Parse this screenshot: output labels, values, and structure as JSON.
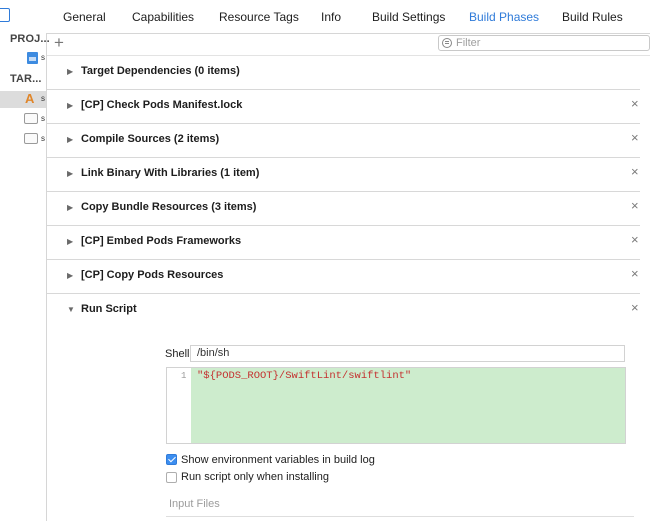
{
  "tabs": [
    "General",
    "Capabilities",
    "Resource Tags",
    "Info",
    "Build Settings",
    "Build Phases",
    "Build Rules"
  ],
  "active_tab": "Build Phases",
  "sidebar": {
    "project_header": "PROJ...",
    "targets_header": "TAR...",
    "item_initial": "s"
  },
  "toolbar": {
    "add_label": "+",
    "filter_placeholder": "Filter"
  },
  "phases": [
    {
      "title": "Target Dependencies (0 items)",
      "expanded": false,
      "removable": false
    },
    {
      "title": "[CP] Check Pods Manifest.lock",
      "expanded": false,
      "removable": true
    },
    {
      "title": "Compile Sources (2 items)",
      "expanded": false,
      "removable": true
    },
    {
      "title": "Link Binary With Libraries (1 item)",
      "expanded": false,
      "removable": true
    },
    {
      "title": "Copy Bundle Resources (3 items)",
      "expanded": false,
      "removable": true
    },
    {
      "title": "[CP] Embed Pods Frameworks",
      "expanded": false,
      "removable": true
    },
    {
      "title": "[CP] Copy Pods Resources",
      "expanded": false,
      "removable": true
    },
    {
      "title": "Run Script",
      "expanded": true,
      "removable": true
    }
  ],
  "run_script": {
    "shell_label": "Shell",
    "shell_value": "/bin/sh",
    "line_number": "1",
    "code": "\"${PODS_ROOT}/SwiftLint/swiftlint\"",
    "show_env_label": "Show environment variables in build log",
    "show_env_checked": true,
    "install_only_label": "Run script only when installing",
    "install_only_checked": false,
    "input_files_label": "Input Files"
  },
  "icons": {
    "collapsed": "▶",
    "expanded": "▼",
    "close": "×"
  },
  "colors": {
    "accent": "#2f7bd9",
    "script_bg": "#cdeccd",
    "code_text": "#c4302f"
  }
}
